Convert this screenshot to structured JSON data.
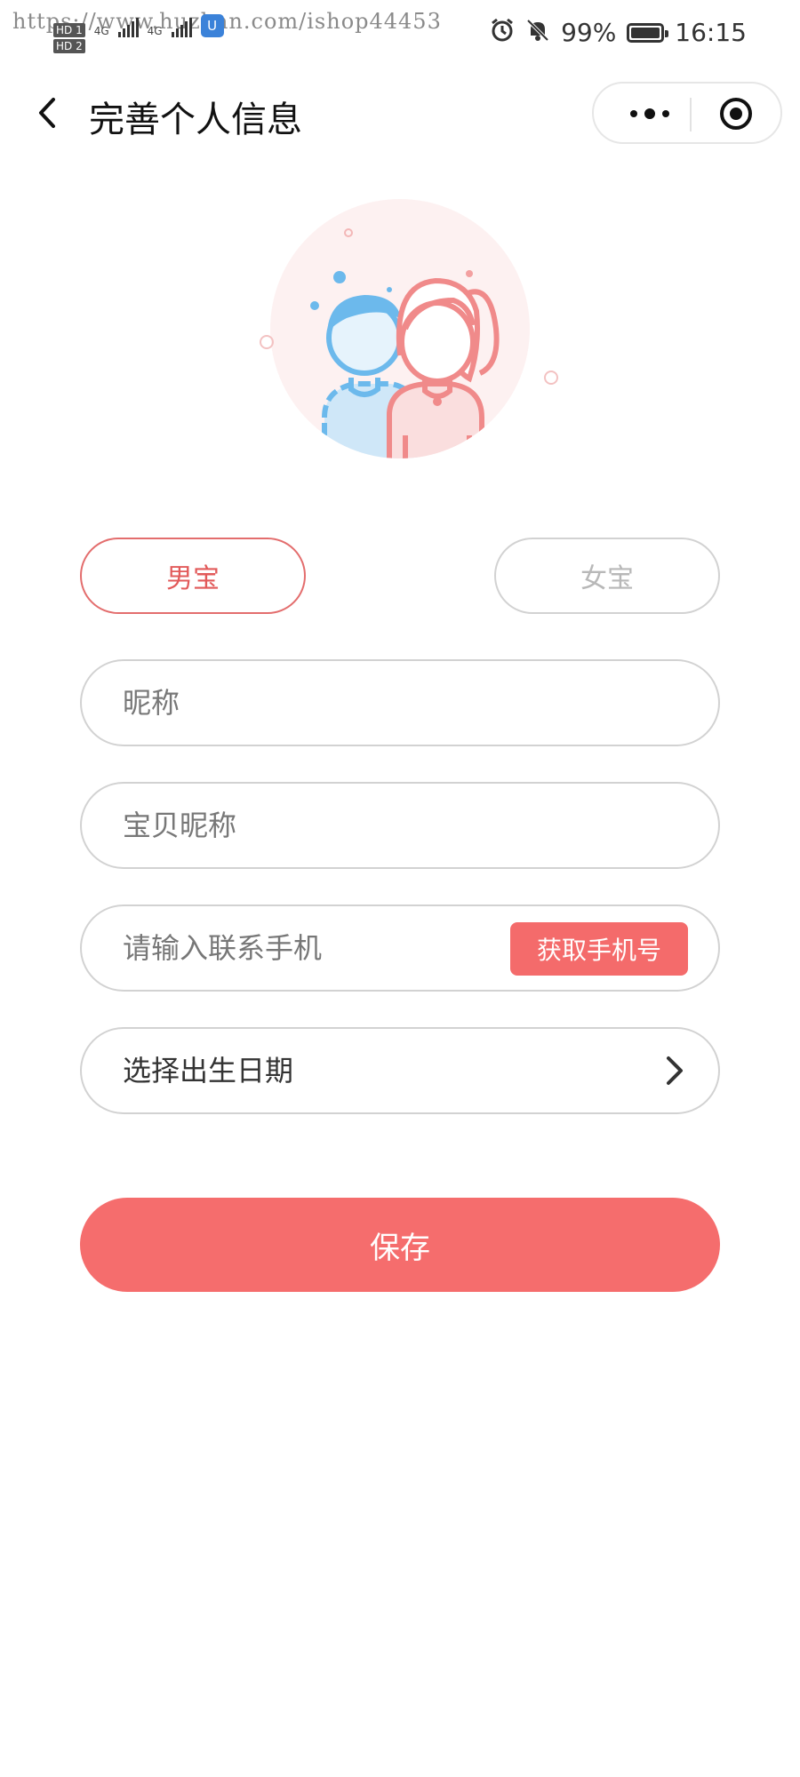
{
  "status_bar": {
    "watermark": "https://www.huzhan.com/ishop44453",
    "hd_badge_1": "HD 1",
    "hd_badge_2": "HD 2",
    "network_1": "4G",
    "network_2": "4G",
    "app_badge": "U",
    "battery_percent": "99%",
    "battery_level": 0.99,
    "time": "16:15",
    "icons": [
      "alarm-icon",
      "bell-mute-icon",
      "battery-icon"
    ]
  },
  "navbar": {
    "title": "完善个人信息",
    "back_icon": "chevron-left-icon",
    "capsule_icons": [
      "more-dots-icon",
      "close-target-icon"
    ]
  },
  "gender": {
    "male_label": "男宝",
    "female_label": "女宝",
    "selected": "male"
  },
  "form": {
    "nickname_placeholder": "昵称",
    "baby_nickname_placeholder": "宝贝昵称",
    "phone_placeholder": "请输入联系手机",
    "get_phone_label": "获取手机号",
    "birthday_label": "选择出生日期"
  },
  "save_label": "保存",
  "colors": {
    "accent": "#f56d6d",
    "male_blue": "#6cb9ec",
    "female_pink": "#f08a8a"
  }
}
